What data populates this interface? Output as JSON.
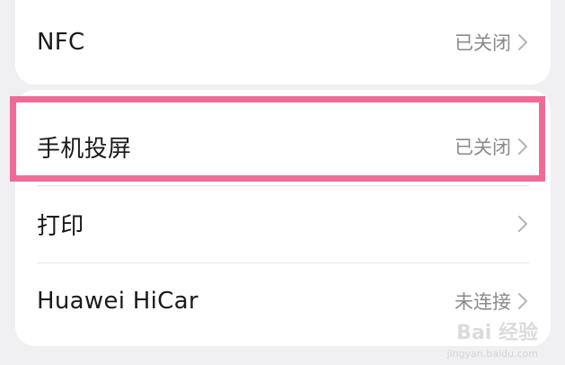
{
  "settings": {
    "nfc": {
      "label": "NFC",
      "value": "已关闭"
    },
    "screen_cast": {
      "label": "手机投屏",
      "value": "已关闭"
    },
    "print": {
      "label": "打印",
      "value": ""
    },
    "hicar": {
      "label": "Huawei HiCar",
      "value": "未连接"
    }
  },
  "watermark": {
    "brand": "Bai 经验",
    "url": "jingyan.baidu.com"
  },
  "colors": {
    "background": "#f0f0f2",
    "card": "#ffffff",
    "highlight_border": "#f06a98",
    "label_text": "#1a1a1a",
    "value_text": "#8a8a8a"
  },
  "icons": {
    "chevron": "chevron-right-icon"
  }
}
